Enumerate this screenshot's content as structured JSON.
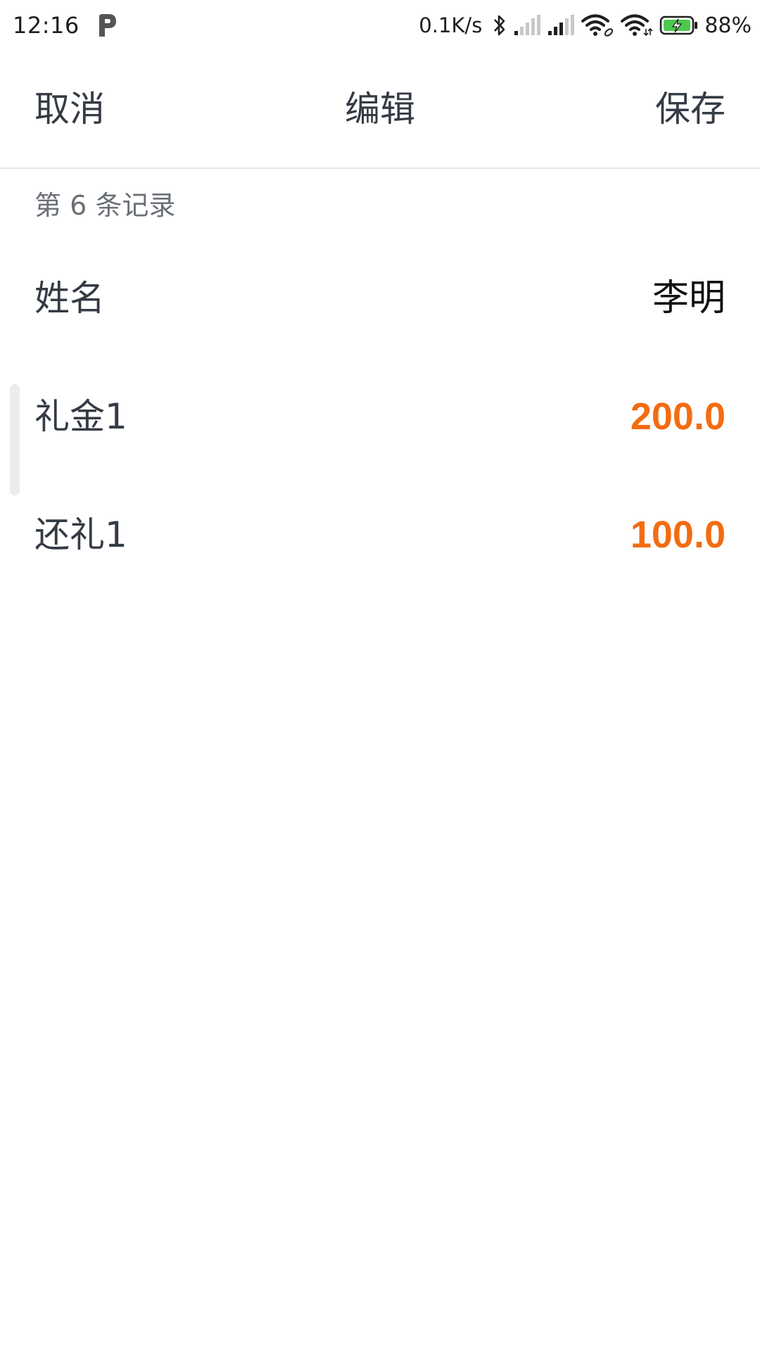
{
  "status_bar": {
    "time": "12:16",
    "net_speed": "0.1K/s",
    "battery_percent": "88%",
    "icons": [
      "p-app-icon",
      "bluetooth-icon",
      "signal-icon",
      "signal-icon",
      "wifi-icon",
      "wifi-icon",
      "battery-charging-icon"
    ]
  },
  "title_bar": {
    "cancel_label": "取消",
    "title": "编辑",
    "save_label": "保存"
  },
  "record": {
    "caption": "第 6 条记录"
  },
  "fields": {
    "name": {
      "label": "姓名",
      "value": "李明"
    },
    "gift": {
      "label": "礼金1",
      "value": "200.0"
    },
    "return_gift": {
      "label": "还礼1",
      "value": "100.0"
    }
  },
  "colors": {
    "amount": "#f26c12",
    "battery_fill": "#4cc94c",
    "text": "#343b45"
  }
}
